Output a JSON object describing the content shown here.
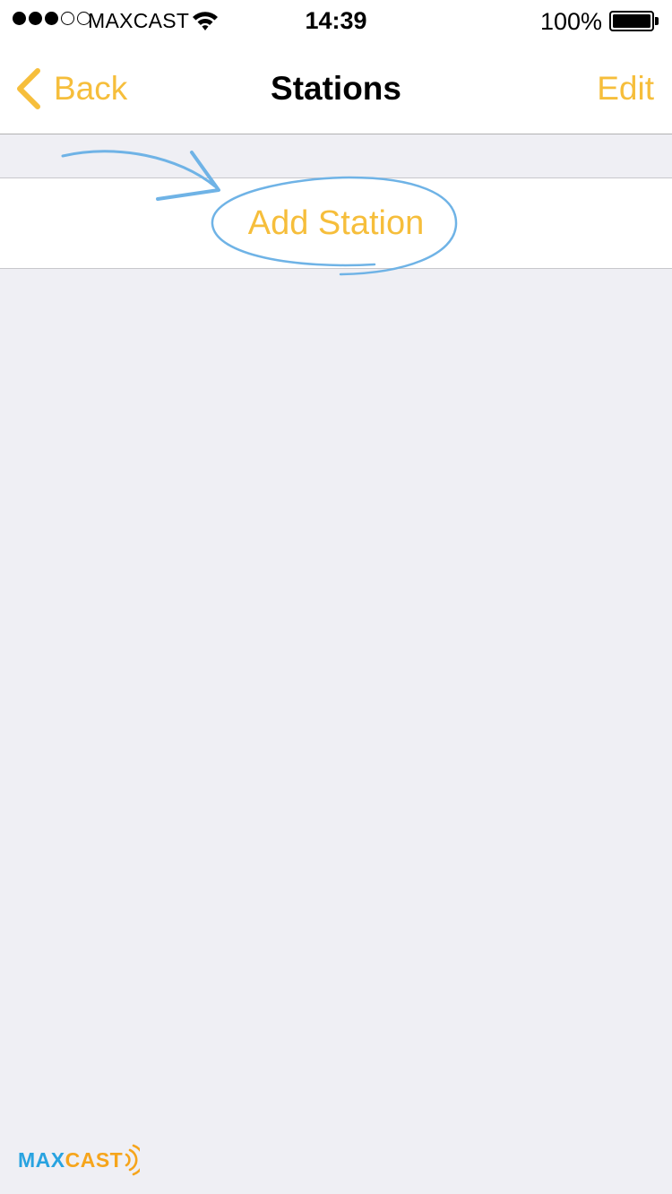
{
  "status_bar": {
    "carrier": "MAXCAST",
    "time": "14:39",
    "battery_percent": "100%",
    "signal_bars_filled": 3,
    "signal_bars_total": 5,
    "wifi_icon": "wifi-icon",
    "battery_icon": "battery-icon"
  },
  "nav": {
    "back_label": "Back",
    "title": "Stations",
    "edit_label": "Edit",
    "back_icon": "chevron-left-icon"
  },
  "list": {
    "add_station_label": "Add Station"
  },
  "watermark": {
    "text_left": "MAX",
    "text_right": "CAST"
  },
  "colors": {
    "accent": "#F6BE3B",
    "background": "#EFEFF4",
    "annotation": "#6FB3E6",
    "watermark_blue": "#29A3E0",
    "watermark_orange": "#F6A51C"
  }
}
